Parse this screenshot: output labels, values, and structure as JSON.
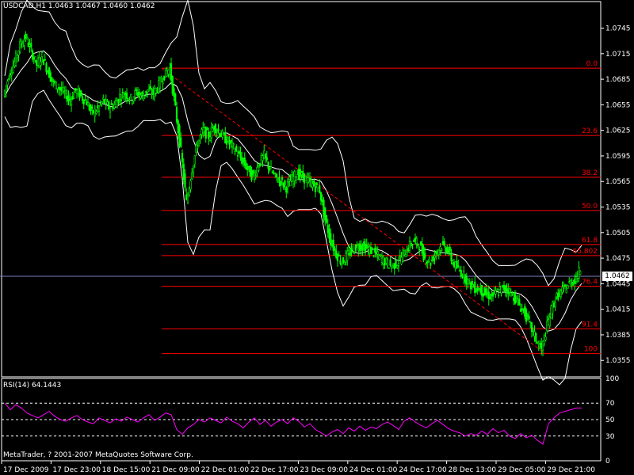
{
  "header": {
    "symbol": "USDCAD,H1",
    "open": "1.0463",
    "high": "1.0467",
    "low": "1.0460",
    "close": "1.0462"
  },
  "current_price_label": "1.0462",
  "rsi_header": "RSI(14) 64.1443",
  "copyright": "MetaTrader, ? 2001-2007 MetaQuotes Software Corp.",
  "colors": {
    "background": "#000000",
    "candle": "#00ff00",
    "bands": "#ffffff",
    "fib": "#ff0000",
    "rsi": "#ff00ff",
    "axis": "#ffffff"
  },
  "chart_data": {
    "type": "candlestick",
    "price_axis": {
      "ticks": [
        "1.0745",
        "1.0715",
        "1.0685",
        "1.0655",
        "1.0625",
        "1.0595",
        "1.0565",
        "1.0535",
        "1.0505",
        "1.0475",
        "1.0445",
        "1.0415",
        "1.0385",
        "1.0355"
      ],
      "range": [
        1.0345,
        1.0765
      ]
    },
    "time_axis": [
      "17 Dec 2009",
      "17 Dec 23:00",
      "18 Dec 15:00",
      "21 Dec 09:00",
      "22 Dec 01:00",
      "22 Dec 17:00",
      "23 Dec 09:00",
      "24 Dec 01:00",
      "24 Dec 17:00",
      "28 Dec 13:00",
      "29 Dec 05:00",
      "29 Dec 21:00"
    ],
    "fibonacci": [
      {
        "label": "0.0",
        "price": 1.0698
      },
      {
        "label": "23.6",
        "price": 1.0619
      },
      {
        "label": "38.2",
        "price": 1.057
      },
      {
        "label": "50.0",
        "price": 1.0531
      },
      {
        "label": "61.8",
        "price": 1.0491
      },
      {
        "label": "65.802",
        "price": 1.0478
      },
      {
        "label": "76.4",
        "price": 1.0442
      },
      {
        "label": "91.4",
        "price": 1.0392
      },
      {
        "label": "100",
        "price": 1.0363
      }
    ],
    "trendline": {
      "from": [
        1.0698
      ],
      "to": [
        1.0363
      ]
    },
    "close_path": [
      1.0665,
      1.069,
      1.0705,
      1.0725,
      1.0735,
      1.0718,
      1.0702,
      1.0712,
      1.0695,
      1.068,
      1.0675,
      1.0668,
      1.066,
      1.0672,
      1.0665,
      1.0658,
      1.0645,
      1.065,
      1.066,
      1.0652,
      1.0655,
      1.0665,
      1.0668,
      1.0662,
      1.067,
      1.0665,
      1.0672,
      1.0668,
      1.0678,
      1.069,
      1.0698,
      1.065,
      1.06,
      1.054,
      1.058,
      1.061,
      1.0625,
      1.0618,
      1.063,
      1.0622,
      1.0615,
      1.0608,
      1.06,
      1.059,
      1.058,
      1.057,
      1.0585,
      1.0595,
      1.058,
      1.057,
      1.0565,
      1.0558,
      1.0568,
      1.0575,
      1.057,
      1.0565,
      1.056,
      1.0555,
      1.052,
      1.0495,
      1.048,
      1.047,
      1.0478,
      1.0485,
      1.049,
      1.0488,
      1.0485,
      1.048,
      1.0475,
      1.047,
      1.0465,
      1.047,
      1.0478,
      1.0488,
      1.0495,
      1.049,
      1.0475,
      1.047,
      1.0482,
      1.049,
      1.0486,
      1.047,
      1.0462,
      1.0455,
      1.0445,
      1.044,
      1.0438,
      1.0432,
      1.043,
      1.0435,
      1.044,
      1.0438,
      1.043,
      1.042,
      1.041,
      1.0395,
      1.038,
      1.0367,
      1.0395,
      1.042,
      1.0432,
      1.0438,
      1.0445,
      1.045,
      1.0462
    ],
    "rsi": {
      "axis_ticks": [
        "100",
        "70",
        "50",
        "30",
        "0"
      ],
      "levels": [
        70,
        50,
        30
      ],
      "values": [
        70,
        62,
        68,
        64,
        58,
        55,
        52,
        56,
        60,
        54,
        50,
        48,
        52,
        55,
        50,
        47,
        45,
        52,
        49,
        46,
        51,
        48,
        53,
        50,
        47,
        52,
        56,
        49,
        53,
        58,
        56,
        38,
        32,
        40,
        44,
        50,
        47,
        52,
        49,
        46,
        53,
        48,
        45,
        40,
        47,
        52,
        44,
        49,
        42,
        47,
        50,
        45,
        52,
        48,
        41,
        45,
        38,
        34,
        30,
        35,
        38,
        33,
        40,
        36,
        42,
        37,
        41,
        39,
        44,
        47,
        43,
        38,
        48,
        52,
        47,
        43,
        40,
        45,
        49,
        44,
        39,
        36,
        34,
        30,
        33,
        31,
        36,
        32,
        39,
        34,
        37,
        30,
        27,
        33,
        28,
        31,
        25,
        20,
        45,
        52,
        58,
        60,
        62,
        64,
        64
      ]
    }
  }
}
